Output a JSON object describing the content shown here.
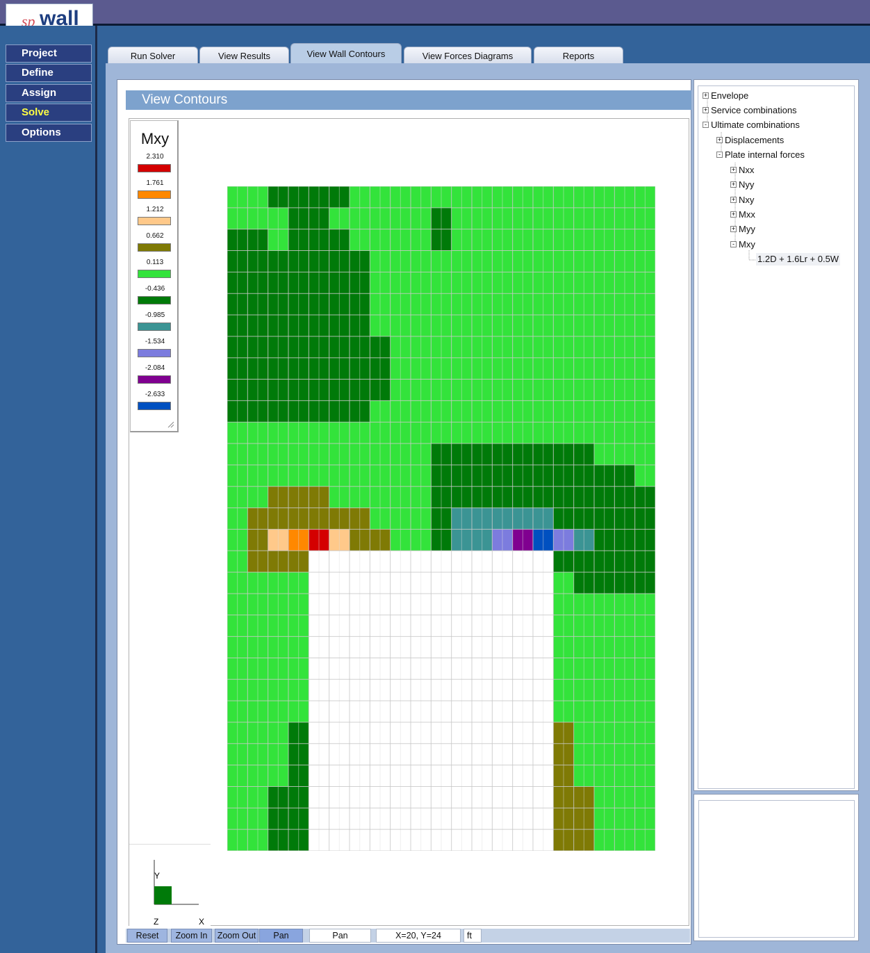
{
  "app": {
    "logo_prefix": "sp",
    "logo_name": "wall"
  },
  "menu": [
    {
      "label": "Project",
      "active": false
    },
    {
      "label": "Define",
      "active": false
    },
    {
      "label": "Assign",
      "active": false
    },
    {
      "label": "Solve",
      "active": true
    },
    {
      "label": "Options",
      "active": false
    }
  ],
  "tabs": [
    {
      "label": "Run Solver",
      "active": false
    },
    {
      "label": "View Results",
      "active": false
    },
    {
      "label": "View Wall Contours",
      "active": true
    },
    {
      "label": "View Forces Diagrams",
      "active": false
    },
    {
      "label": "Reports",
      "active": false
    }
  ],
  "view": {
    "title": "View Contours"
  },
  "legend": {
    "title": "Mxy",
    "entries": [
      {
        "value": "2.310",
        "color": "#d40000"
      },
      {
        "value": "1.761",
        "color": "#ff8800"
      },
      {
        "value": "1.212",
        "color": "#ffc98a"
      },
      {
        "value": "0.662",
        "color": "#7f7a05"
      },
      {
        "value": "0.113",
        "color": "#33e33b"
      },
      {
        "value": "-0.436",
        "color": "#007a09"
      },
      {
        "value": "-0.985",
        "color": "#3b9494"
      },
      {
        "value": "-1.534",
        "color": "#7c7cde"
      },
      {
        "value": "-2.084",
        "color": "#800090"
      },
      {
        "value": "-2.633",
        "color": "#0050c0"
      }
    ]
  },
  "axis": {
    "y_label": "Y",
    "z_label": "Z",
    "x_label": "X"
  },
  "toolbar": {
    "reset": "Reset",
    "zoom_in": "Zoom In",
    "zoom_out": "Zoom Out",
    "pan": "Pan",
    "mode": "Pan",
    "coords": "X=20, Y=24",
    "units": "ft"
  },
  "tree": {
    "items": [
      {
        "label": "Envelope",
        "expander": "+"
      },
      {
        "label": "Service combinations",
        "expander": "+"
      },
      {
        "label": "Ultimate combinations",
        "expander": "-"
      },
      {
        "label": "Displacements",
        "expander": "+"
      },
      {
        "label": "Plate internal forces",
        "expander": "-"
      },
      {
        "label": "Nxx",
        "expander": "+"
      },
      {
        "label": "Nyy",
        "expander": "+"
      },
      {
        "label": "Nxy",
        "expander": "+"
      },
      {
        "label": "Mxx",
        "expander": "+"
      },
      {
        "label": "Myy",
        "expander": "+"
      },
      {
        "label": "Mxy",
        "expander": "-"
      },
      {
        "label": "1.2D + 1.6Lr + 0.5W",
        "expander": ""
      }
    ]
  },
  "contour": {
    "opening_color": "#ffffff",
    "rows": [
      "GGDDDDGGGGGGGGGGGGGGG",
      "GGGDDGGGGGDGGGGGGGGGG",
      "DDGDDDGGGGDGGGGGGGGGG",
      "DDDDDDDGGGGGGGGGGGGGG",
      "DDDDDDDGGGGGGGGGGGGGG",
      "DDDDDDDGGGGGGGGGGGGGG",
      "DDDDDDDGGGGGGGGGGGGGG",
      "DDDDDDDDGGGGGGGGGGGGG",
      "DDDDDDDDGGGGGGGGGGGGG",
      "DDDDDDDDGGGGGGGGGGGGG",
      "DDDDDDDGGGGGGGGGGGGGG",
      "GGGGGGGGGGGGGGGGGGGGG",
      "GGGGGGGGGGDDDDDDDDGGG",
      "GGGGGGGGGGDDDDDDDDDDG",
      "GGOOOGGGGGDDDDDDDDDDD",
      "GOOOOOOGGGDTTTTTDDDDD",
      "GOYNRYOOGGDTTLPBLTDDD",
      "GOOOWWWWWWWWWWWWDDDDD",
      "GGGGWWWWWWWWWWWWGDDDD",
      "GGGGWWWWWWWWWWWWGGGGG",
      "GGGGWWWWWWWWWWWWGGGGG",
      "GGGGWWWWWWWWWWWWGGGGG",
      "GGGGWWWWWWWWWWWWGGGGG",
      "GGGGWWWWWWWWWWWWGGGGG",
      "GGGGWWWWWWWWWWWWGGGGG",
      "GGGDWWWWWWWWWWWWOGGGG",
      "GGGDWWWWWWWWWWWWOGGGG",
      "GGGDWWWWWWWWWWWWOGGGG",
      "GGDDWWWWWWWWWWWWOOGGG",
      "GGDDWWWWWWWWWWWWOOGGG",
      "GGDDWWWWWWWWWWWWOOGGG"
    ],
    "color_key": {
      "R": "#d40000",
      "N": "#ff8800",
      "Y": "#ffc98a",
      "O": "#7f7a05",
      "G": "#33e33b",
      "D": "#007a09",
      "T": "#3b9494",
      "L": "#7c7cde",
      "P": "#800090",
      "B": "#0050c0",
      "W": "#ffffff"
    }
  }
}
